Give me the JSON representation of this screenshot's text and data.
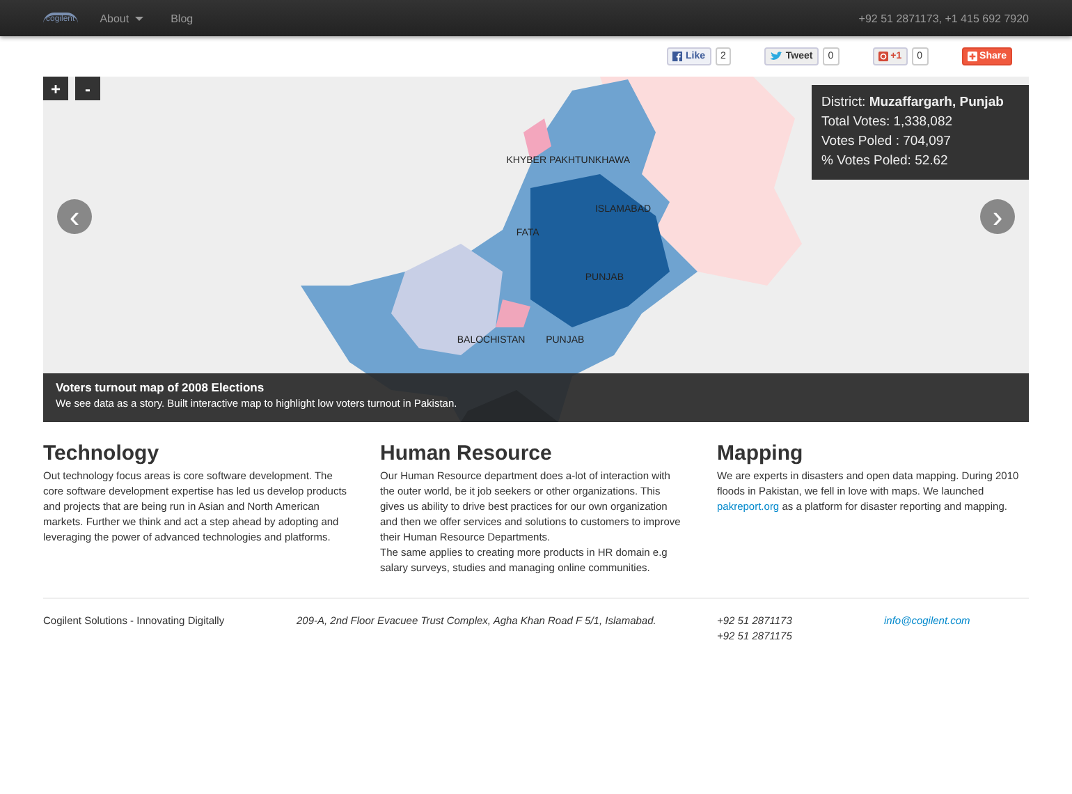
{
  "navbar": {
    "logo_text": "cogilent",
    "items": [
      {
        "label": "About",
        "dropdown": true
      },
      {
        "label": "Blog",
        "dropdown": false
      }
    ],
    "contact": "+92 51 2871173, +1 415 692 7920"
  },
  "social": [
    {
      "kind": "facebook",
      "label": "Like",
      "count": "2"
    },
    {
      "kind": "twitter",
      "label": "Tweet",
      "count": "0"
    },
    {
      "kind": "gplus",
      "label": "+1",
      "count": "0"
    },
    {
      "kind": "share",
      "label": "Share"
    }
  ],
  "map": {
    "zoom_in": "+",
    "zoom_out": "-",
    "prev": "‹",
    "next": "›",
    "labels": [
      "KHYBER PAKHTUNKHAWA",
      "ISLAMABAD",
      "FATA",
      "PUNJAB",
      "BALOCHISTAN",
      "PUNJAB"
    ],
    "tooltip": {
      "district_label": "District:",
      "district": "Muzaffargarh, Punjab",
      "lines": [
        "Total Votes: 1,338,082",
        "Votes Poled : 704,097",
        "% Votes Poled: 52.62"
      ]
    },
    "caption": {
      "title": "Voters turnout map of 2008 Elections",
      "text": "We see data as a story. Built interactive map to highlight low voters turnout in Pakistan."
    }
  },
  "sections": [
    {
      "heading": "Technology",
      "paragraphs": [
        {
          "parts": [
            {
              "kind": "text",
              "text": "Out technology focus areas is core software development. The core software development expertise has led us develop products and projects that are being run in Asian and North American markets. Further we think and act a step ahead by adopting and leveraging the power of advanced technologies and platforms."
            }
          ]
        }
      ]
    },
    {
      "heading": "Human Resource",
      "paragraphs": [
        {
          "parts": [
            {
              "kind": "text",
              "text": "Our Human Resource department does a-lot of interaction with the outer world, be it job seekers or other organizations. This gives us ability to drive best practices for our own organization and then we offer services and solutions to customers to improve their Human Resource Departments."
            }
          ]
        },
        {
          "parts": [
            {
              "kind": "text",
              "text": "The same applies to creating more products in HR domain e.g salary surveys, studies and managing online communities."
            }
          ]
        }
      ]
    },
    {
      "heading": "Mapping",
      "paragraphs": [
        {
          "parts": [
            {
              "kind": "text",
              "text": "We are experts in disasters and open data mapping. During 2010 floods in Pakistan, we fell in love with maps. We launched "
            },
            {
              "kind": "link",
              "text": "pakreport.org"
            },
            {
              "kind": "text",
              "text": " as a platform for disaster reporting and mapping."
            }
          ]
        }
      ]
    }
  ],
  "footer": {
    "company": "Cogilent Solutions - Innovating Digitally",
    "address": "209-A, 2nd Floor Evacuee Trust Complex, Agha Khan Road F 5/1, Islamabad.",
    "phones": [
      "+92 51 2871173",
      "+92 51 2871175"
    ],
    "email": "info@cogilent.com"
  }
}
